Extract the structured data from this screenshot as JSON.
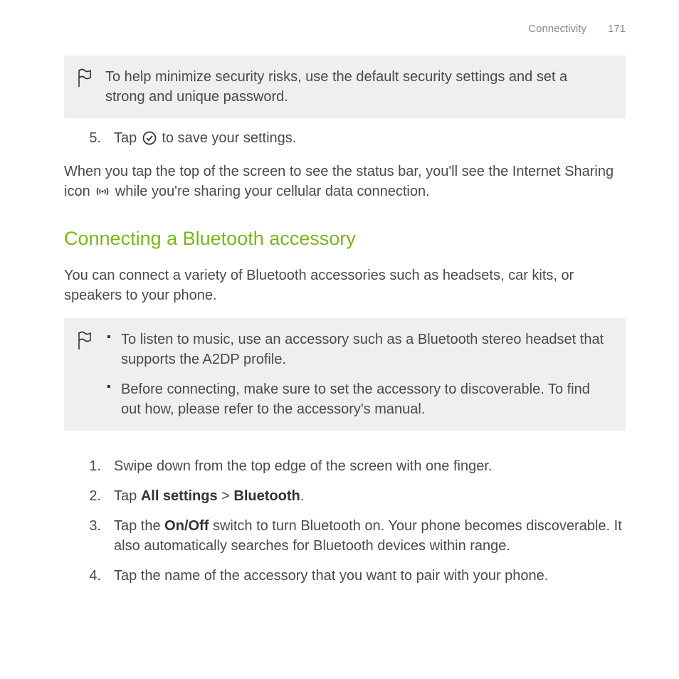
{
  "header": {
    "section": "Connectivity",
    "page": "171"
  },
  "callout1": {
    "text": "To help minimize security risks, use the default security settings and set a strong and unique password."
  },
  "step5": {
    "num": "5.",
    "before": "Tap ",
    "after": " to save your settings."
  },
  "para1": {
    "before": "When you tap the top of the screen to see the status bar, you'll see the Internet Sharing icon ",
    "after": " while you're sharing your cellular data connection."
  },
  "heading": "Connecting a Bluetooth accessory",
  "para2": "You can connect a variety of Bluetooth accessories such as headsets, car kits, or speakers to your phone.",
  "callout2": {
    "bullet1": "To listen to music, use an accessory such as a Bluetooth stereo headset that supports the A2DP profile.",
    "bullet2": "Before connecting, make sure to set the accessory to discoverable. To find out how, please refer to the accessory's manual."
  },
  "steps": {
    "s1num": "1.",
    "s1": "Swipe down from the top edge of the screen with one finger.",
    "s2num": "2.",
    "s2a": "Tap ",
    "s2b": "All settings",
    "s2c": " > ",
    "s2d": "Bluetooth",
    "s2e": ".",
    "s3num": "3.",
    "s3a": "Tap the ",
    "s3b": "On/Off",
    "s3c": " switch to turn Bluetooth on. Your phone becomes discoverable. It also automatically searches for Bluetooth devices within range.",
    "s4num": "4.",
    "s4": "Tap the name of the accessory that you want to pair with your phone."
  }
}
